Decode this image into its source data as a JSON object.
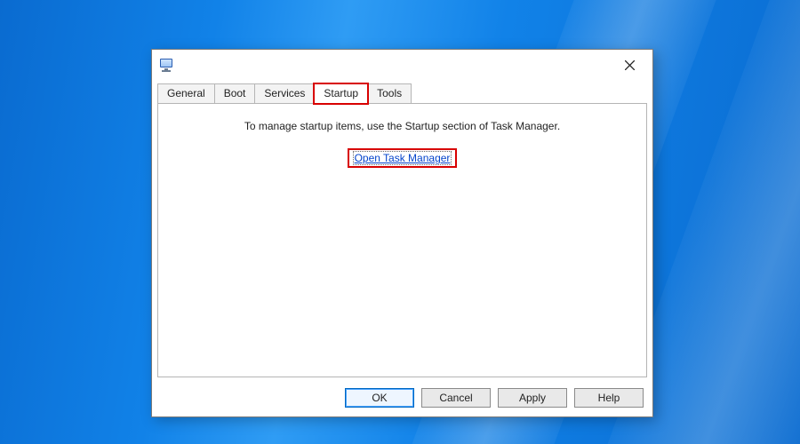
{
  "tabs": {
    "general": "General",
    "boot": "Boot",
    "services": "Services",
    "startup": "Startup",
    "tools": "Tools",
    "active": "startup"
  },
  "startup_panel": {
    "info": "To manage startup items, use the Startup section of Task Manager.",
    "link": "Open Task Manager"
  },
  "buttons": {
    "ok": "OK",
    "cancel": "Cancel",
    "apply": "Apply",
    "help": "Help"
  }
}
